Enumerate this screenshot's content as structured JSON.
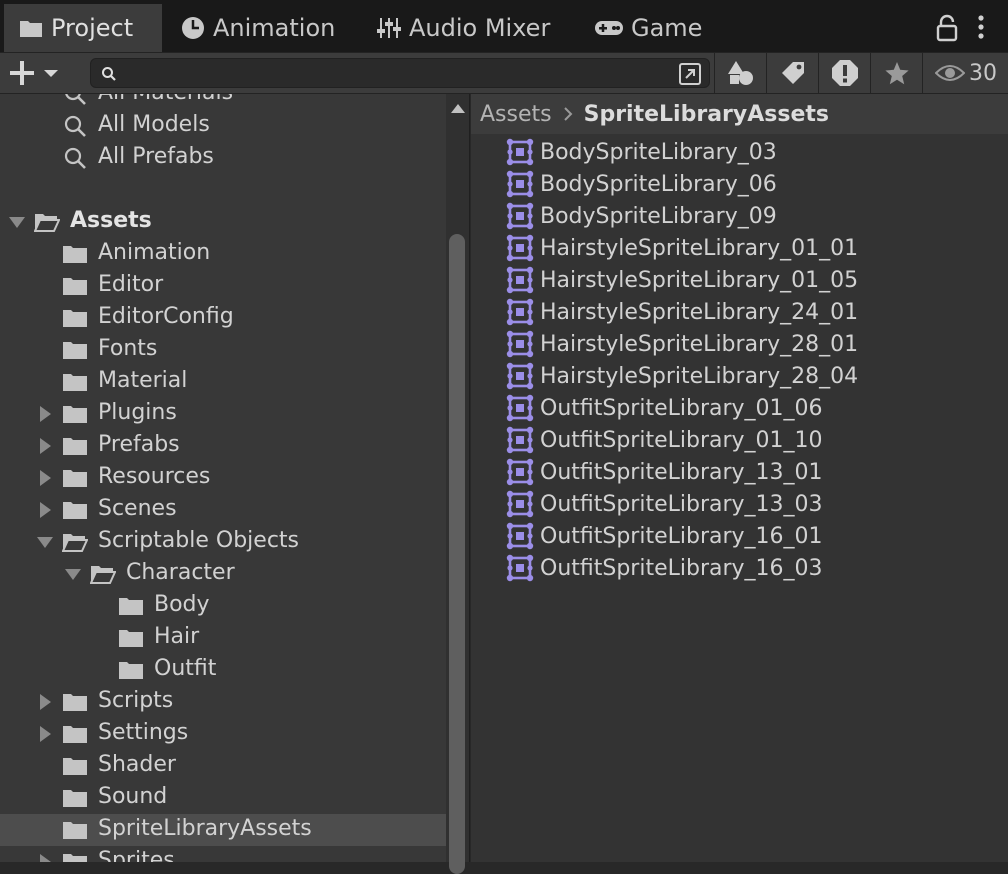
{
  "tabs": [
    {
      "label": "Project",
      "icon": "folder-icon",
      "active": true
    },
    {
      "label": "Animation",
      "icon": "clock-icon",
      "active": false
    },
    {
      "label": "Audio Mixer",
      "icon": "mixer-icon",
      "active": false
    },
    {
      "label": "Game",
      "icon": "gamepad-icon",
      "active": false
    }
  ],
  "toolbar": {
    "search": {
      "value": "",
      "placeholder": ""
    },
    "hidden_packages_count": "30"
  },
  "tree": [
    {
      "label": "All Materials",
      "icon": "search-icon",
      "indent": 1,
      "expander": "none"
    },
    {
      "label": "All Models",
      "icon": "search-icon",
      "indent": 1,
      "expander": "none"
    },
    {
      "label": "All Prefabs",
      "icon": "search-icon",
      "indent": 1,
      "expander": "none"
    },
    {
      "label": "",
      "icon": "",
      "indent": 0,
      "expander": "none"
    },
    {
      "label": "Assets",
      "icon": "folder-open-icon",
      "indent": 0,
      "expander": "expanded",
      "bold": true
    },
    {
      "label": "Animation",
      "icon": "folder-icon",
      "indent": 1,
      "expander": "none"
    },
    {
      "label": "Editor",
      "icon": "folder-icon",
      "indent": 1,
      "expander": "none"
    },
    {
      "label": "EditorConfig",
      "icon": "folder-icon",
      "indent": 1,
      "expander": "none"
    },
    {
      "label": "Fonts",
      "icon": "folder-icon",
      "indent": 1,
      "expander": "none"
    },
    {
      "label": "Material",
      "icon": "folder-icon",
      "indent": 1,
      "expander": "none"
    },
    {
      "label": "Plugins",
      "icon": "folder-icon",
      "indent": 1,
      "expander": "collapsed"
    },
    {
      "label": "Prefabs",
      "icon": "folder-icon",
      "indent": 1,
      "expander": "collapsed"
    },
    {
      "label": "Resources",
      "icon": "folder-icon",
      "indent": 1,
      "expander": "collapsed"
    },
    {
      "label": "Scenes",
      "icon": "folder-icon",
      "indent": 1,
      "expander": "collapsed"
    },
    {
      "label": "Scriptable Objects",
      "icon": "folder-open-icon",
      "indent": 1,
      "expander": "expanded"
    },
    {
      "label": "Character",
      "icon": "folder-open-icon",
      "indent": 2,
      "expander": "expanded"
    },
    {
      "label": "Body",
      "icon": "folder-icon",
      "indent": 3,
      "expander": "none"
    },
    {
      "label": "Hair",
      "icon": "folder-icon",
      "indent": 3,
      "expander": "none"
    },
    {
      "label": "Outfit",
      "icon": "folder-icon",
      "indent": 3,
      "expander": "none"
    },
    {
      "label": "Scripts",
      "icon": "folder-icon",
      "indent": 1,
      "expander": "collapsed"
    },
    {
      "label": "Settings",
      "icon": "folder-icon",
      "indent": 1,
      "expander": "collapsed"
    },
    {
      "label": "Shader",
      "icon": "folder-icon",
      "indent": 1,
      "expander": "none"
    },
    {
      "label": "Sound",
      "icon": "folder-icon",
      "indent": 1,
      "expander": "none"
    },
    {
      "label": "SpriteLibraryAssets",
      "icon": "folder-icon",
      "indent": 1,
      "expander": "none",
      "selected": true
    },
    {
      "label": "Sprites",
      "icon": "folder-icon",
      "indent": 1,
      "expander": "collapsed"
    }
  ],
  "breadcrumb": {
    "root": "Assets",
    "current": "SpriteLibraryAssets"
  },
  "assets": [
    "BodySpriteLibrary_03",
    "BodySpriteLibrary_06",
    "BodySpriteLibrary_09",
    "HairstyleSpriteLibrary_01_01",
    "HairstyleSpriteLibrary_01_05",
    "HairstyleSpriteLibrary_24_01",
    "HairstyleSpriteLibrary_28_01",
    "HairstyleSpriteLibrary_28_04",
    "OutfitSpriteLibrary_01_06",
    "OutfitSpriteLibrary_01_10",
    "OutfitSpriteLibrary_13_01",
    "OutfitSpriteLibrary_13_03",
    "OutfitSpriteLibrary_16_01",
    "OutfitSpriteLibrary_16_03"
  ],
  "colors": {
    "asset_icon": "#9b8ee8",
    "icon_gray": "#c4c4c4",
    "selected_row": "#4d4d4d"
  }
}
